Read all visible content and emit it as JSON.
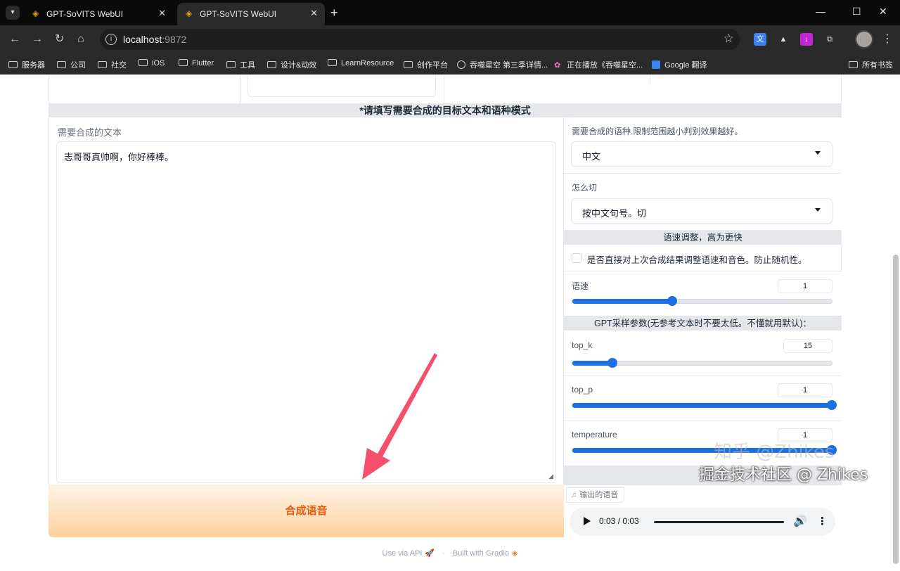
{
  "browser": {
    "tabs": [
      {
        "title": "GPT-SoVITS WebUI",
        "active": false
      },
      {
        "title": "GPT-SoVITS WebUI",
        "active": true
      }
    ],
    "url_host": "localhost",
    "url_port": ":9872",
    "bookmarks": [
      {
        "label": "服务器",
        "icon": "folder-icon"
      },
      {
        "label": "公司",
        "icon": "folder-icon"
      },
      {
        "label": "社交",
        "icon": "folder-icon"
      },
      {
        "label": "iOS",
        "icon": "folder-icon"
      },
      {
        "label": "Flutter",
        "icon": "folder-icon"
      },
      {
        "label": "工具",
        "icon": "folder-icon"
      },
      {
        "label": "设计&动效",
        "icon": "folder-icon"
      },
      {
        "label": "LearnResource",
        "icon": "folder-icon"
      },
      {
        "label": "创作平台",
        "icon": "folder-icon"
      },
      {
        "label": "吞噬星空 第三季详情...",
        "icon": "globe-icon"
      },
      {
        "label": "正在播放《吞噬星空...",
        "icon": "flower-icon"
      },
      {
        "label": "Google 翻译",
        "icon": "google-translate-icon"
      }
    ],
    "all_bookmarks": "所有书签"
  },
  "section": {
    "header": "*请填写需要合成的目标文本和语种模式"
  },
  "left": {
    "text_label": "需要合成的文本",
    "text_value": "志哥哥真帅啊，你好棒棒。",
    "synth_button": "合成语音"
  },
  "right": {
    "lang_label": "需要合成的语种.限制范围越小判别效果越好。",
    "lang_value": "中文",
    "cut_label": "怎么切",
    "cut_value": "按中文句号。切",
    "speed_header": "语速调整，高为更快",
    "checkbox_label": "是否直接对上次合成结果调整语速和音色。防止随机性。",
    "checkbox_checked": false,
    "gpt_header": "GPT采样参数(无参考文本时不要太低。不懂就用默认)：",
    "sliders": [
      {
        "label": "语速",
        "value": "1",
        "fraction": 0.385
      },
      {
        "label": "top_k",
        "value": "15",
        "fraction": 0.155
      },
      {
        "label": "top_p",
        "value": "1",
        "fraction": 1.0
      },
      {
        "label": "temperature",
        "value": "1",
        "fraction": 1.0
      }
    ],
    "output_label": "输出的语音",
    "audio_time": "0:03 / 0:03"
  },
  "footer": {
    "api_text": "Use via API",
    "separator": "·",
    "built_with": "Built with Gradio"
  },
  "watermark": {
    "line1": "知乎 @Zhikes",
    "line2": "掘金技术社区 @ Zhikes"
  },
  "colors": {
    "accent": "#1d6fe6",
    "button_text": "#ea580c",
    "section_bg": "#e5e7eb"
  }
}
